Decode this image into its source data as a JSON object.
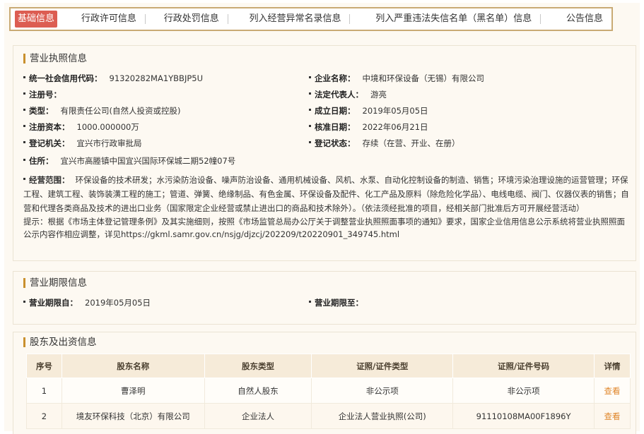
{
  "tabs": [
    "基础信息",
    "行政许可信息",
    "行政处罚信息",
    "列入经营异常名录信息",
    "列入严重违法失信名单（黑名单）信息",
    "公告信息"
  ],
  "license": {
    "title": "营业执照信息",
    "credit_code_label": "统一社会信用代码：",
    "credit_code": "91320282MA1YBBJP5U",
    "company_name_label": "企业名称：",
    "company_name": "中境和环保设备（无锡）有限公司",
    "reg_no_label": "注册号：",
    "reg_no": "",
    "legal_rep_label": "法定代表人：",
    "legal_rep": "游亮",
    "type_label": "类型：",
    "type": "有限责任公司(自然人投资或控股)",
    "est_date_label": "成立日期：",
    "est_date": "2019年05月05日",
    "capital_label": "注册资本：",
    "capital": "1000.000000万",
    "approve_date_label": "核准日期：",
    "approve_date": "2022年06月21日",
    "authority_label": "登记机关：",
    "authority": "宜兴市行政审批局",
    "status_label": "登记状态：",
    "status": "存续（在营、开业、在册）",
    "address_label": "住所：",
    "address": "宜兴市高塍镇中国宜兴国际环保城二期52幢07号",
    "scope_label": "经营范围：",
    "scope": "环保设备的技术研发；水污染防治设备、噪声防治设备、通用机械设备、风机、水泵、自动化控制设备的制造、销售；环境污染治理设施的运营管理；环保工程、建筑工程、装饰装潢工程的施工；管道、弹簧、绝缘制品、有色金属、环保设备及配件、化工产品及原料（除危险化学品）、电线电缆、阀门、仪器仪表的销售；自营和代理各类商品及技术的进出口业务（国家限定企业经营或禁止进出口的商品和技术除外）。（依法须经批准的项目，经相关部门批准后方可开展经营活动）",
    "tip": "提示：根据《市场主体登记管理条例》及其实施细则，按照《市场监管总局办公厅关于调整营业执照照面事项的通知》要求，国家企业信用信息公示系统将营业执照照面公示内容作相应调整，详见https://gkml.samr.gov.cn/nsjg/djzcj/202209/t20220901_349745.html"
  },
  "period": {
    "title": "营业期限信息",
    "start_label": "营业期限自：",
    "start": "2019年05月05日",
    "end_label": "营业期限至：",
    "end": ""
  },
  "shareholders": {
    "title": "股东及出资信息",
    "headers": [
      "序号",
      "股东名称",
      "股东类型",
      "证照/证件类型",
      "证照/证件号码",
      "详情"
    ],
    "rows": [
      {
        "no": "1",
        "name": "曹泽明",
        "type": "自然人股东",
        "id_type": "非公示项",
        "id_no": "非公示项",
        "detail": "查看"
      },
      {
        "no": "2",
        "name": "境友环保科技（北京）有限公司",
        "type": "企业法人",
        "id_type": "企业法人营业执照(公司)",
        "id_no": "91110108MA00F1896Y",
        "detail": "查看"
      }
    ]
  },
  "colors": {
    "active_tab": "#dc5d52",
    "tab_border": "#c9aa74",
    "title_bar": "#c9902e",
    "link": "#e0872c",
    "table_header": "#f6ebd9"
  }
}
